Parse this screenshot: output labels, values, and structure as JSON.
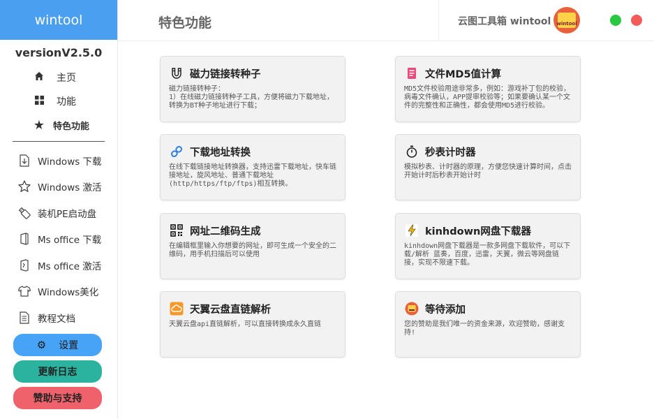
{
  "sidebar": {
    "brand": "wintool",
    "version": "versionV2.5.0",
    "top_nav": [
      {
        "label": "主页",
        "icon": "home-icon"
      },
      {
        "label": "功能",
        "icon": "grid-icon"
      },
      {
        "label": "特色功能",
        "icon": "star-icon"
      }
    ],
    "nav_items": [
      {
        "label": "Windows 下载",
        "icon": "download-icon"
      },
      {
        "label": "Windows 激活",
        "icon": "star-outline-icon"
      },
      {
        "label": "装机PE启动盘",
        "icon": "usb-icon"
      },
      {
        "label": "Ms office 下载",
        "icon": "office-icon"
      },
      {
        "label": "Ms office 激活",
        "icon": "office-key-icon"
      },
      {
        "label": "Windows美化",
        "icon": "shirt-icon"
      },
      {
        "label": "教程文档",
        "icon": "document-icon"
      }
    ],
    "buttons": {
      "settings": "设置",
      "changelog": "更新日志",
      "support": "赞助与支持"
    }
  },
  "header": {
    "title": "特色功能",
    "brand_right": "云图工具箱 wintool",
    "avatar_text": "wintool"
  },
  "cards": [
    {
      "title": "磁力链接转种子",
      "icon": "magnet-icon",
      "desc": "磁力链接转种子：\n1）在线磁力链接转种子工具，方便将磁力下载地址，转换为BT种子地址进行下载；"
    },
    {
      "title": "文件MD5值计算",
      "icon": "file-md5-icon",
      "desc": "MD5文件校验用途非常多，例如：游戏补丁包的校验，病毒文件确认，APP提审校验等；如果要确认某一个文件的完整性和正确性，都会使用MD5进行校验。"
    },
    {
      "title": "下载地址转换",
      "icon": "link-icon",
      "desc": "在线下载链接地址转换器，支持迅雷下载地址，快车链接地址，旋风地址、普通下载地址(http/https/ftp/ftps)相互转换。"
    },
    {
      "title": "秒表计时器",
      "icon": "stopwatch-icon",
      "desc": "模拟秒表、计时器的原理，方便您快速计算时间，点击开始计时后秒表开始计时"
    },
    {
      "title": "网址二维码生成",
      "icon": "qrcode-icon",
      "desc": "在编辑框里输入你想要的网址，即可生成一个安全的二维码，用手机扫描后可以使用"
    },
    {
      "title": "kinhdown网盘下载器",
      "icon": "lightning-icon",
      "desc": "kinhdown网盘下载器是一款多网盘下载软件，可以下载/解析 蓝奏，百度，迅雷，天翼，微云等网盘链接，实现不限速下载。"
    },
    {
      "title": "天翼云盘直链解析",
      "icon": "cloud-icon",
      "desc": "天翼云盘api直链解析，可以直接转换成永久直链"
    },
    {
      "title": "等待添加",
      "icon": "wintool-logo-icon",
      "desc": "您的赞助是我们唯一的资金来源，欢迎赞助，感谢支持!"
    }
  ]
}
